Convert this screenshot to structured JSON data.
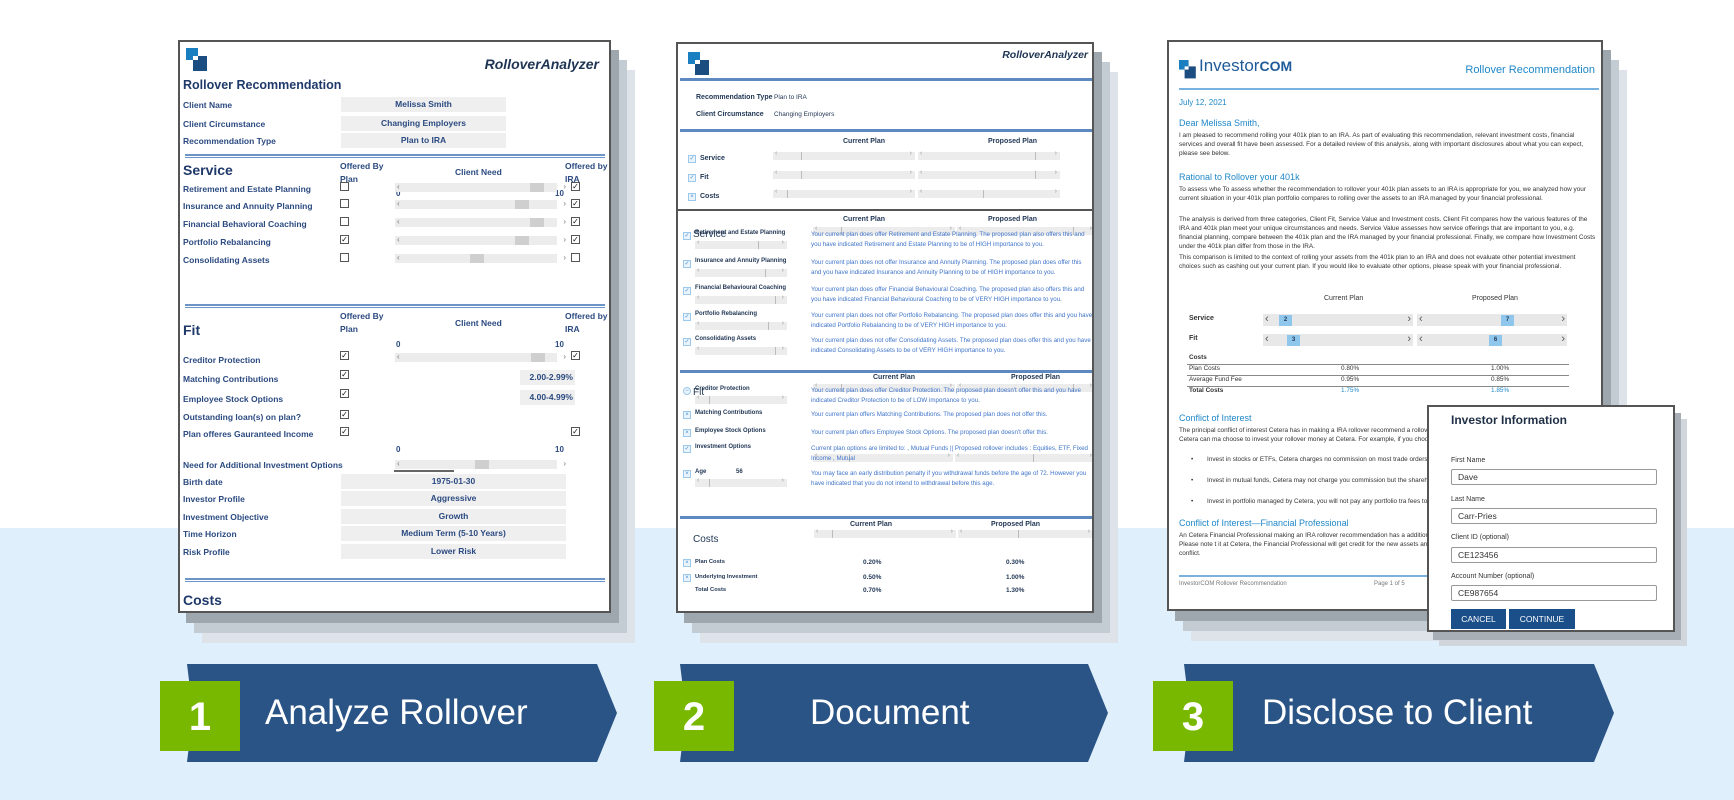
{
  "brand_colors": {
    "navy": "#2a5485",
    "green": "#78b800",
    "band": "#dfeffc",
    "link_blue": "#1f87c8"
  },
  "panel1": {
    "app_title": "RolloverAnalyzer",
    "heading": "Rollover Recommendation",
    "client_fields": [
      {
        "label": "Client Name",
        "value": "Melissa Smith"
      },
      {
        "label": "Client Circumstance",
        "value": "Changing Employers"
      },
      {
        "label": "Recommendation Type",
        "value": "Plan to IRA"
      }
    ],
    "service": {
      "title": "Service",
      "col_offered_plan": "Offered By Plan",
      "col_client_need": "Client Need",
      "col_offered_ira": "Offered by IRA",
      "scale_min": "0",
      "scale_max": "10",
      "rows": [
        {
          "label": "Retirement and Estate Planning",
          "offered_by_plan": false,
          "client_need": 9,
          "offered_by_ira": true
        },
        {
          "label": "Insurance and Annuity Planning",
          "offered_by_plan": false,
          "client_need": 8,
          "offered_by_ira": true
        },
        {
          "label": "Financial Behavioral Coaching",
          "offered_by_plan": false,
          "client_need": 9,
          "offered_by_ira": true
        },
        {
          "label": "Portfolio Rebalancing",
          "offered_by_plan": true,
          "client_need": 8,
          "offered_by_ira": true
        },
        {
          "label": "Consolidating Assets",
          "offered_by_plan": false,
          "client_need": 5,
          "offered_by_ira": false
        }
      ]
    },
    "fit": {
      "title": "Fit",
      "col_offered_plan": "Offered By Plan",
      "col_client_need": "Client Need",
      "col_offered_ira": "Offered by IRA",
      "scale_min": "0",
      "scale_max": "10",
      "creditor_protection": {
        "label": "Creditor Protection",
        "offered_by_plan": true,
        "client_need": 9,
        "offered_by_ira": true
      },
      "matching": {
        "label": "Matching Contributions",
        "offered_by_plan": true,
        "value": "2.00-2.99%"
      },
      "stock_options": {
        "label": "Employee Stock Options",
        "offered_by_plan": true,
        "value": "4.00-4.99%"
      },
      "loans": {
        "label": "Outstanding loan(s) on plan?",
        "offered_by_plan": true
      },
      "guaranteed_income": {
        "label": "Plan offeres Gauranteed Income",
        "offered_by_plan": true,
        "offered_by_ira": true
      },
      "additional_options": {
        "label": "Need for Additional Investment Options",
        "client_need": 5
      },
      "profile_fields": [
        {
          "label": "Birth date",
          "value": "1975-01-30"
        },
        {
          "label": "Investor Profile",
          "value": "Aggressive"
        },
        {
          "label": "Investment Objective",
          "value": "Growth"
        },
        {
          "label": "Time Horizon",
          "value": "Medium Term (5-10 Years)"
        },
        {
          "label": "Risk Profile",
          "value": "Lower Risk"
        }
      ]
    },
    "costs_title": "Costs"
  },
  "panel2": {
    "app_title": "RolloverAnalyzer",
    "summary_fields": [
      {
        "label": "Recommendation Type",
        "value": "Plan to IRA"
      },
      {
        "label": "Client Circumstance",
        "value": "Changing Employers"
      }
    ],
    "col_current": "Current Plan",
    "col_proposed": "Proposed Plan",
    "summary_rows": [
      {
        "label": "Service",
        "current": 2,
        "proposed": 9
      },
      {
        "label": "Fit",
        "current": 2,
        "proposed": 9
      },
      {
        "label": "Costs",
        "current": 1,
        "proposed": 5
      }
    ],
    "service": {
      "title": "Service",
      "current": 2,
      "proposed": 9,
      "rows": [
        {
          "label": "Retirement and Estate Planning",
          "text": "Your current plan does offer Retirement and Estate Planning. The proposed plan also offers this and you have indicated Retirement and Estate Planning to be of HIGH importance to you."
        },
        {
          "label": "Insurance and Annuity Planning",
          "text": "Your current plan does not offer Insurance and Annuity Planning. The proposed plan does offer this and you have indicated Insurance and Annuity Planning to be of HIGH importance to you."
        },
        {
          "label": "Financial Behavioural Coaching",
          "text": "Your current plan does offer Financial Behavioural Coaching. The proposed plan also offers this and you have indicated Financial Behavioural Coaching to be of VERY HIGH importance to you."
        },
        {
          "label": "Portfolio Rebalancing",
          "text": "Your current plan does not offer Portfolio Rebalancing. The proposed plan does offer this and you have indicated Portfolio Rebalancing to be of VERY HIGH importance to you."
        },
        {
          "label": "Consolidating Assets",
          "text": "Your current plan does not offer Consolidating Assets. The proposed plan does offer this and you have indicated Consolidating Assets to be of VERY HIGH importance to you."
        }
      ]
    },
    "fit": {
      "title": "Fit",
      "rows": [
        {
          "label": "Creditor Protection",
          "text": "Your current plan does offer Creditor Protection. The proposed plan doesn't offer this and you have indicated Creditor Protection to be of LOW importance to you."
        },
        {
          "label": "Matching Contributions",
          "text": "Your current plan offers Matching Contributions. The proposed plan does not offer this."
        },
        {
          "label": "Employee Stock Options",
          "text": "Your current plan offers Employee Stock Options. The proposed plan doesn't offer this."
        },
        {
          "label": "Investment Options",
          "text": "Current plan options are limited to: , Mutual Funds || Proposed rollover includes : Equities, ETF, Fixed Income , Mutual"
        },
        {
          "label": "Age",
          "age_value": "56",
          "text": "You may face an early distribution penalty if you withdrawal funds before the age of 72. However you have indicated that you do not intend to withdrawal before this age."
        }
      ]
    },
    "costs": {
      "title": "Costs",
      "rows": [
        {
          "label": "Plan Costs",
          "current": "0.20%",
          "proposed": "0.30%"
        },
        {
          "label": "Underlying Investment",
          "current": "0.50%",
          "proposed": "1.00%"
        },
        {
          "label": "Total Costs",
          "current": "0.70%",
          "proposed": "1.30%"
        }
      ]
    }
  },
  "panel3": {
    "brand": "Investor",
    "brand_suffix": "COM",
    "doc_title": "Rollover Recommendation",
    "date": "July 12, 2021",
    "greeting": "Dear Melissa Smith,",
    "intro": "I am pleased to recommend rolling your 401k plan to an IRA. As part of evaluating this recommendation, relevant investment costs, financial services and overall fit have been assessed. For a detailed review of this analysis, along with important disclosures about what you can expect, please see below.",
    "rationale_heading": "Rational to Rollover your 401k",
    "rationale_p1": "To assess whe To assess whether the recommendation to rollover your 401k plan assets to an IRA is appropriate for you, we analyzed how your current situation in your 401k plan portfolio compares to rolling over the assets to an IRA managed by your financial professional.",
    "rationale_p2": "The analysis is derived from three categories, Client Fit, Service Value and Investment costs. Client Fit compares how the various features of the IRA and 401k plan meet your unique circumstances and needs. Service Value assesses how service offerings that are important to you, e.g. financial planning, compare between the 401k plan and the IRA managed by your financial professional. Finally, we compare how Investment Costs under the 401k plan differ from those in the IRA.",
    "rationale_p3": "This comparison is limited to the context of rolling your assets from the 401k plan to an IRA and does not evaluate other potential investment choices such as cashing out your current plan. If you would like to evaluate other options, please speak with your financial professional.",
    "col_current": "Current Plan",
    "col_proposed": "Proposed Plan",
    "scores": [
      {
        "label": "Service",
        "current": "2",
        "proposed": "7"
      },
      {
        "label": "Fit",
        "current": "3",
        "proposed": "6"
      }
    ],
    "costs_label": "Costs",
    "cost_rows": [
      {
        "label": "Plan Costs",
        "current": "0.80%",
        "proposed": "1.00%"
      },
      {
        "label": "Average Fund Fee",
        "current": "0.95%",
        "proposed": "0.85%"
      },
      {
        "label": "Total Costs",
        "current": "1.75%",
        "proposed": "1.85%"
      }
    ],
    "coi_heading": "Conflict of Interest",
    "coi_text": "The principal conflict of interest Cetera has in making a IRA rollover recommend a rollover to a Cetera IRA and will not make money if you do not. Cetera can ma choose to invest your rollover money at Cetera. For example, if you choose to:",
    "coi_bullets": [
      "Invest in stocks or ETFs, Cetera charges no commission on most trade orders to third parties that make payments to it for order flow.",
      "Invest in mutual funds, Cetera may not charge you commission but the shareholder services and other activities.",
      "Invest in portfolio managed by Cetera, you will not pay any portfolio tra fees to Cetera."
    ],
    "coi_fp_heading": "Conflict of Interest—Financial Professional",
    "coi_fp_text": "An Cetera Financial Professional making an IRA rollover recommendation has a additional money if you accept a recommendation to do a rollover. Please note t it at Cetera, the Financial Professional will get credit for the new assets and may procedures, and supervision in place to mitigate the conflict.",
    "footer_left": "InvestorCOM Rollover Recommendation",
    "footer_right": "Page 1 of 5"
  },
  "dialog": {
    "title": "Investor Information",
    "fields": [
      {
        "label": "First Name",
        "value": "Dave"
      },
      {
        "label": "Last Name",
        "value": "Carr-Pries"
      },
      {
        "label": "Client ID (optional)",
        "value": "CE123456"
      },
      {
        "label": "Account Number (optional)",
        "value": "CE987654"
      }
    ],
    "cancel_label": "CANCEL",
    "continue_label": "CONTINUE"
  },
  "steps": [
    {
      "number": "1",
      "label": "Analyze Rollover"
    },
    {
      "number": "2",
      "label": "Document"
    },
    {
      "number": "3",
      "label": "Disclose to Client"
    }
  ]
}
